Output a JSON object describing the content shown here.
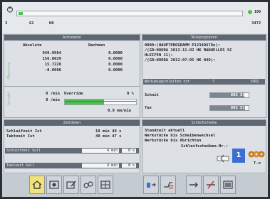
{
  "topbar": {
    "left_num": "3",
    "mid_label": "G1",
    "mid2": "H8",
    "right_top": "100",
    "right_bottom": "3472"
  },
  "panels": {
    "achs_title": "Achsdaten",
    "tp_title": "Teileprogramm",
    "zeit_title": "Zeitdaten",
    "schl_title": "Schleifscheibe"
  },
  "axes": {
    "col1": "Absolute",
    "col2": "Rechnen",
    "rows": [
      {
        "abs": "949.9984",
        "rech": "0.0000"
      },
      {
        "abs": "156.0029",
        "rech": "0.0000"
      },
      {
        "abs": "15.7228",
        "rech": "0.0000"
      },
      {
        "abs": "-0.0006",
        "rech": "0.0000"
      }
    ],
    "side_label": "Maschine"
  },
  "program": {
    "lines": [
      "0000:(HAUPTPROGRAMM P1234O678o):",
      "/(GR:HOORA 2012-11-02 HK MANUELLES SC",
      "HLEIFEN 11):",
      "/(GR:HOORA 2012-07-05 HK H4O):"
    ],
    "status_row": {
      "label": "Werkzeugschleifen.txt",
      "num1": "7",
      "num2": "15R2"
    },
    "bars": [
      {
        "label": "Schnit",
        "value": "863 Stk",
        "fill": 0.88
      },
      {
        "label": "Tas",
        "value": "863 Stk",
        "fill": 0.9
      }
    ]
  },
  "feed": {
    "r1_val": "0 /min",
    "r2_val": "0 /min",
    "override_label": "Override",
    "override_val": "0 %",
    "speed": "0.0 mm/min",
    "side_label": "Spindel",
    "fill": 0.55
  },
  "zeit": {
    "rows": [
      {
        "label": "Schleifzeit Ist",
        "val": "10 min  49 s"
      },
      {
        "label": "Taktzeit Ist",
        "val": "40 min  47 s"
      }
    ],
    "sollrows": [
      {
        "label": "Schleifzeit Soll",
        "min": "4 min",
        "s": "0 s"
      },
      {
        "label": "Taktzeit Soll",
        "min": "4 min",
        "s": "8 s"
      }
    ]
  },
  "schleif": {
    "lines": [
      "Standzeit aktuell",
      "Werkstücke bis Scheibenwechsel",
      "Werkstücke bis Abrichten"
    ],
    "nr_label": "Schleifscheiben-Nr.:",
    "nr_value": "1",
    "icon_label": "T.n"
  },
  "toolbar": {
    "items": [
      "home-icon",
      "axes-icon",
      "program-icon",
      "tool-icon",
      "settings-icon",
      "align-icon",
      "wheel-icon",
      "arrow-right-icon",
      "disable-icon",
      "display-icon"
    ]
  },
  "colors": {
    "accent_blue": "#3a6fd6",
    "green": "#4fbf4f",
    "header": "#5d6772"
  }
}
